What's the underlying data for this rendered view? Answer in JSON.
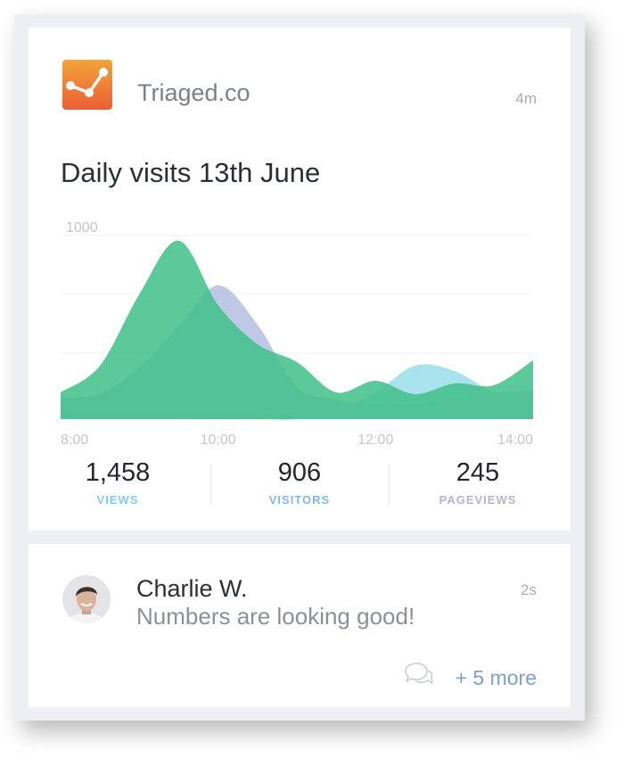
{
  "post": {
    "source": "Triaged.co",
    "time_ago": "4m",
    "title": "Daily visits 13th June"
  },
  "chart_data": {
    "type": "area",
    "x_tick_labels": [
      "8:00",
      "10:00",
      "12:00",
      "14:00"
    ],
    "y_tick_labels": [
      "1000"
    ],
    "x": [
      8.0,
      8.5,
      9.0,
      9.5,
      10.0,
      10.5,
      11.0,
      11.5,
      12.0,
      12.5,
      13.0,
      13.5,
      14.0
    ],
    "series": [
      {
        "color": "#3fc08a",
        "values": [
          150,
          300,
          700,
          1000,
          640,
          420,
          320,
          150,
          215,
          140,
          200,
          190,
          330
        ]
      },
      {
        "color": "#b4c0e2",
        "values": [
          120,
          140,
          290,
          520,
          750,
          530,
          180,
          110,
          75,
          80,
          120,
          150,
          160
        ]
      },
      {
        "color": "#9fdfea",
        "values": [
          0,
          0,
          0,
          0,
          0,
          0,
          0,
          50,
          150,
          300,
          270,
          150,
          90
        ]
      }
    ],
    "ylim": [
      0,
      1100
    ],
    "grid": true
  },
  "stats": [
    {
      "value": "1,458",
      "label": "VIEWS",
      "color": "#7fcde6"
    },
    {
      "value": "906",
      "label": "VISITORS",
      "color": "#7fb8e4"
    },
    {
      "value": "245",
      "label": "PAGEVIEWS",
      "color": "#b0b6cf"
    }
  ],
  "comment": {
    "author": "Charlie W.",
    "message": "Numbers are looking good!",
    "time_ago": "2s",
    "more_link": "+ 5 more",
    "icon": "comments-icon"
  },
  "colors": {
    "logo_top": "#f3a33b",
    "logo_bottom": "#ea5f35",
    "link": "#7d9ed0"
  }
}
